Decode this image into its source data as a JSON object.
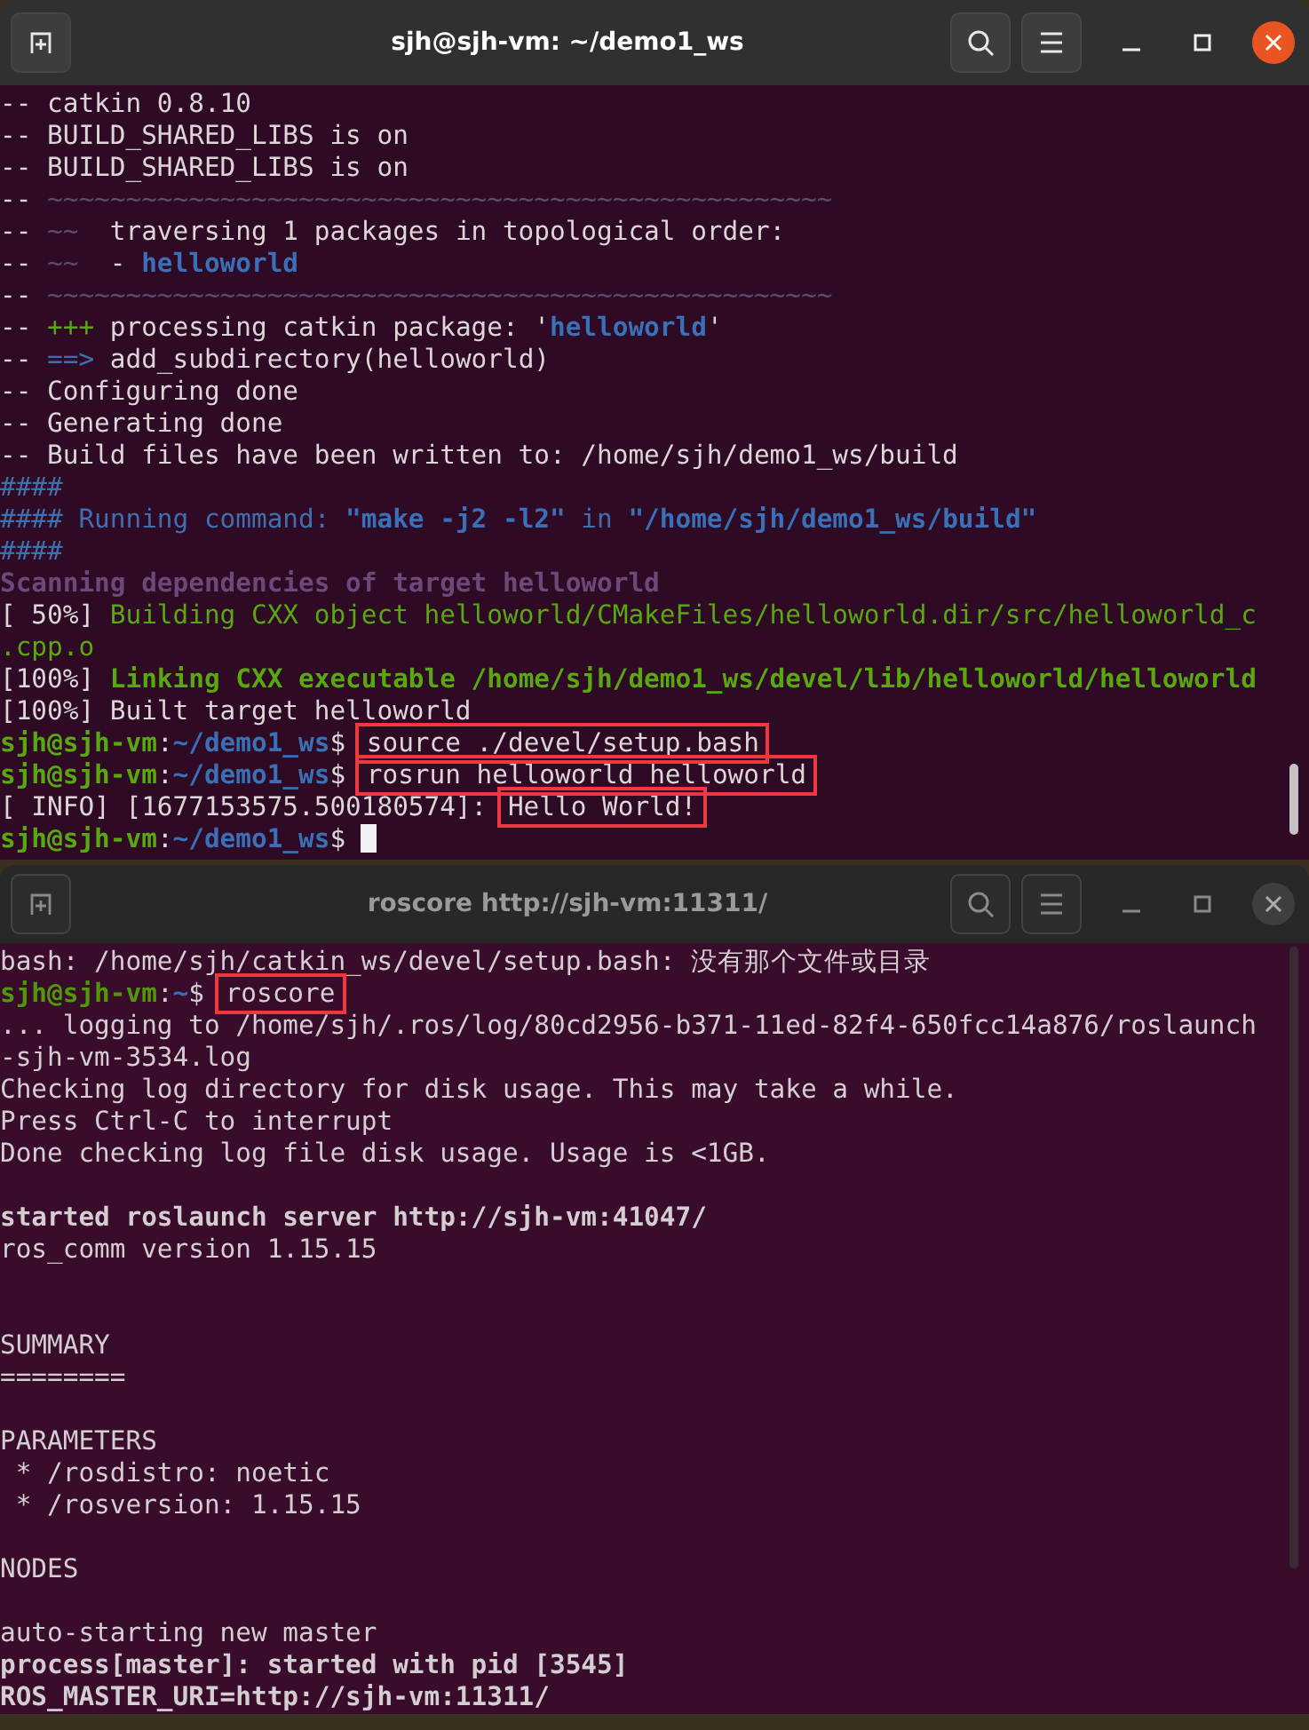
{
  "windows": [
    {
      "title": "sjh@sjh-vm: ~/demo1_ws",
      "active": true,
      "lines": [
        {
          "kind": "text",
          "segments": [
            {
              "kind": "plain",
              "text": "-- catkin 0.8.10"
            }
          ]
        },
        {
          "kind": "text",
          "segments": [
            {
              "kind": "plain",
              "text": "-- BUILD_SHARED_LIBS is on"
            }
          ]
        },
        {
          "kind": "text",
          "segments": [
            {
              "kind": "plain",
              "text": "-- BUILD_SHARED_LIBS is on"
            }
          ]
        },
        {
          "kind": "text",
          "segments": [
            {
              "kind": "plain",
              "text": "-- "
            },
            {
              "kind": "dim",
              "text": "~~~~~~~~~~~~~~~~~~~~~~~~~~~~~~~~~~~~~~~~~~~~~~~~~~"
            }
          ]
        },
        {
          "kind": "text",
          "segments": [
            {
              "kind": "plain",
              "text": "-- "
            },
            {
              "kind": "dim",
              "text": "~~"
            },
            {
              "kind": "plain",
              "text": "  traversing 1 packages in topological order:"
            }
          ]
        },
        {
          "kind": "text",
          "segments": [
            {
              "kind": "plain",
              "text": "-- "
            },
            {
              "kind": "dim",
              "text": "~~"
            },
            {
              "kind": "plain",
              "text": "  - "
            },
            {
              "kind": "bluebold",
              "text": "helloworld"
            }
          ]
        },
        {
          "kind": "text",
          "segments": [
            {
              "kind": "plain",
              "text": "-- "
            },
            {
              "kind": "dim",
              "text": "~~~~~~~~~~~~~~~~~~~~~~~~~~~~~~~~~~~~~~~~~~~~~~~~~~"
            }
          ]
        },
        {
          "kind": "text",
          "segments": [
            {
              "kind": "plain",
              "text": "-- "
            },
            {
              "kind": "green",
              "text": "+++"
            },
            {
              "kind": "plain",
              "text": " processing catkin package: '"
            },
            {
              "kind": "bluebold",
              "text": "helloworld"
            },
            {
              "kind": "plain",
              "text": "'"
            }
          ]
        },
        {
          "kind": "text",
          "segments": [
            {
              "kind": "plain",
              "text": "-- "
            },
            {
              "kind": "blue",
              "text": "==>"
            },
            {
              "kind": "plain",
              "text": " add_subdirectory(helloworld)"
            }
          ]
        },
        {
          "kind": "text",
          "segments": [
            {
              "kind": "plain",
              "text": "-- Configuring done"
            }
          ]
        },
        {
          "kind": "text",
          "segments": [
            {
              "kind": "plain",
              "text": "-- Generating done"
            }
          ]
        },
        {
          "kind": "text",
          "segments": [
            {
              "kind": "plain",
              "text": "-- Build files have been written to: /home/sjh/demo1_ws/build"
            }
          ]
        },
        {
          "kind": "text",
          "segments": [
            {
              "kind": "blue",
              "text": "####"
            }
          ]
        },
        {
          "kind": "text",
          "segments": [
            {
              "kind": "blue",
              "text": "#### Running command: "
            },
            {
              "kind": "bluebold",
              "text": "\"make -j2 -l2\""
            },
            {
              "kind": "blue",
              "text": " in "
            },
            {
              "kind": "bluebold",
              "text": "\"/home/sjh/demo1_ws/build\""
            }
          ]
        },
        {
          "kind": "text",
          "segments": [
            {
              "kind": "blue",
              "text": "####"
            }
          ]
        },
        {
          "kind": "text",
          "segments": [
            {
              "kind": "purplebold",
              "text": "Scanning dependencies of target helloworld"
            }
          ]
        },
        {
          "kind": "text",
          "segments": [
            {
              "kind": "plain",
              "text": "[ 50%] "
            },
            {
              "kind": "green",
              "text": "Building CXX object helloworld/CMakeFiles/helloworld.dir/src/helloworld_c"
            }
          ]
        },
        {
          "kind": "text",
          "segments": [
            {
              "kind": "green",
              "text": ".cpp.o"
            }
          ]
        },
        {
          "kind": "text",
          "segments": [
            {
              "kind": "plain",
              "text": "[100%] "
            },
            {
              "kind": "greenbold",
              "text": "Linking CXX executable /home/sjh/demo1_ws/devel/lib/helloworld/helloworld"
            }
          ]
        },
        {
          "kind": "text",
          "segments": [
            {
              "kind": "plain",
              "text": "[100%] Built target helloworld"
            }
          ]
        },
        {
          "kind": "text",
          "segments": [
            {
              "kind": "greenbold",
              "text": "sjh@sjh-vm"
            },
            {
              "kind": "plain",
              "text": ":"
            },
            {
              "kind": "bluebold",
              "text": "~/demo1_ws"
            },
            {
              "kind": "plain",
              "text": "$ "
            },
            {
              "kind": "plain",
              "text": "source ./devel/setup.bash",
              "boxed": true
            }
          ]
        },
        {
          "kind": "text",
          "segments": [
            {
              "kind": "greenbold",
              "text": "sjh@sjh-vm"
            },
            {
              "kind": "plain",
              "text": ":"
            },
            {
              "kind": "bluebold",
              "text": "~/demo1_ws"
            },
            {
              "kind": "plain",
              "text": "$ "
            },
            {
              "kind": "plain",
              "text": "rosrun helloworld helloworld",
              "boxed": true
            }
          ]
        },
        {
          "kind": "text",
          "segments": [
            {
              "kind": "plain",
              "text": "[ INFO] [1677153575.500180574]: "
            },
            {
              "kind": "plain",
              "text": "Hello World!",
              "boxed": true
            }
          ]
        },
        {
          "kind": "text",
          "cursor": true,
          "segments": [
            {
              "kind": "greenbold",
              "text": "sjh@sjh-vm"
            },
            {
              "kind": "plain",
              "text": ":"
            },
            {
              "kind": "bluebold",
              "text": "~/demo1_ws"
            },
            {
              "kind": "plain",
              "text": "$ "
            }
          ]
        }
      ]
    },
    {
      "title": "roscore http://sjh-vm:11311/",
      "active": false,
      "lines": [
        {
          "kind": "text",
          "segments": [
            {
              "kind": "plain",
              "text": "bash: /home/sjh/catkin_ws/devel/setup.bash: 没有那个文件或目录"
            }
          ]
        },
        {
          "kind": "text",
          "segments": [
            {
              "kind": "greenbold",
              "text": "sjh@sjh-vm"
            },
            {
              "kind": "plain",
              "text": ":"
            },
            {
              "kind": "bluebold",
              "text": "~"
            },
            {
              "kind": "plain",
              "text": "$ "
            },
            {
              "kind": "plain",
              "text": "roscore",
              "boxed": true
            }
          ]
        },
        {
          "kind": "text",
          "segments": [
            {
              "kind": "plain",
              "text": "... logging to /home/sjh/.ros/log/80cd2956-b371-11ed-82f4-650fcc14a876/roslaunch"
            }
          ]
        },
        {
          "kind": "text",
          "segments": [
            {
              "kind": "plain",
              "text": "-sjh-vm-3534.log"
            }
          ]
        },
        {
          "kind": "text",
          "segments": [
            {
              "kind": "plain",
              "text": "Checking log directory for disk usage. This may take a while."
            }
          ]
        },
        {
          "kind": "text",
          "segments": [
            {
              "kind": "plain",
              "text": "Press Ctrl-C to interrupt"
            }
          ]
        },
        {
          "kind": "text",
          "segments": [
            {
              "kind": "plain",
              "text": "Done checking log file disk usage. Usage is <1GB."
            }
          ]
        },
        {
          "kind": "blank"
        },
        {
          "kind": "text",
          "segments": [
            {
              "kind": "bold",
              "text": "started roslaunch server http://sjh-vm:41047/"
            }
          ]
        },
        {
          "kind": "text",
          "segments": [
            {
              "kind": "plain",
              "text": "ros_comm version 1.15.15"
            }
          ]
        },
        {
          "kind": "blank"
        },
        {
          "kind": "blank"
        },
        {
          "kind": "text",
          "segments": [
            {
              "kind": "plain",
              "text": "SUMMARY"
            }
          ]
        },
        {
          "kind": "text",
          "segments": [
            {
              "kind": "plain",
              "text": "========"
            }
          ]
        },
        {
          "kind": "blank"
        },
        {
          "kind": "text",
          "segments": [
            {
              "kind": "plain",
              "text": "PARAMETERS"
            }
          ]
        },
        {
          "kind": "text",
          "segments": [
            {
              "kind": "plain",
              "text": " * /rosdistro: noetic"
            }
          ]
        },
        {
          "kind": "text",
          "segments": [
            {
              "kind": "plain",
              "text": " * /rosversion: 1.15.15"
            }
          ]
        },
        {
          "kind": "blank"
        },
        {
          "kind": "text",
          "segments": [
            {
              "kind": "plain",
              "text": "NODES"
            }
          ]
        },
        {
          "kind": "blank"
        },
        {
          "kind": "text",
          "segments": [
            {
              "kind": "plain",
              "text": "auto-starting new master"
            }
          ]
        },
        {
          "kind": "text",
          "segments": [
            {
              "kind": "bold",
              "text": "process[master]: started with pid [3545]"
            }
          ]
        },
        {
          "kind": "text",
          "segments": [
            {
              "kind": "bold",
              "text": "ROS_MASTER_URI=http://sjh-vm:11311/"
            }
          ]
        }
      ]
    }
  ]
}
